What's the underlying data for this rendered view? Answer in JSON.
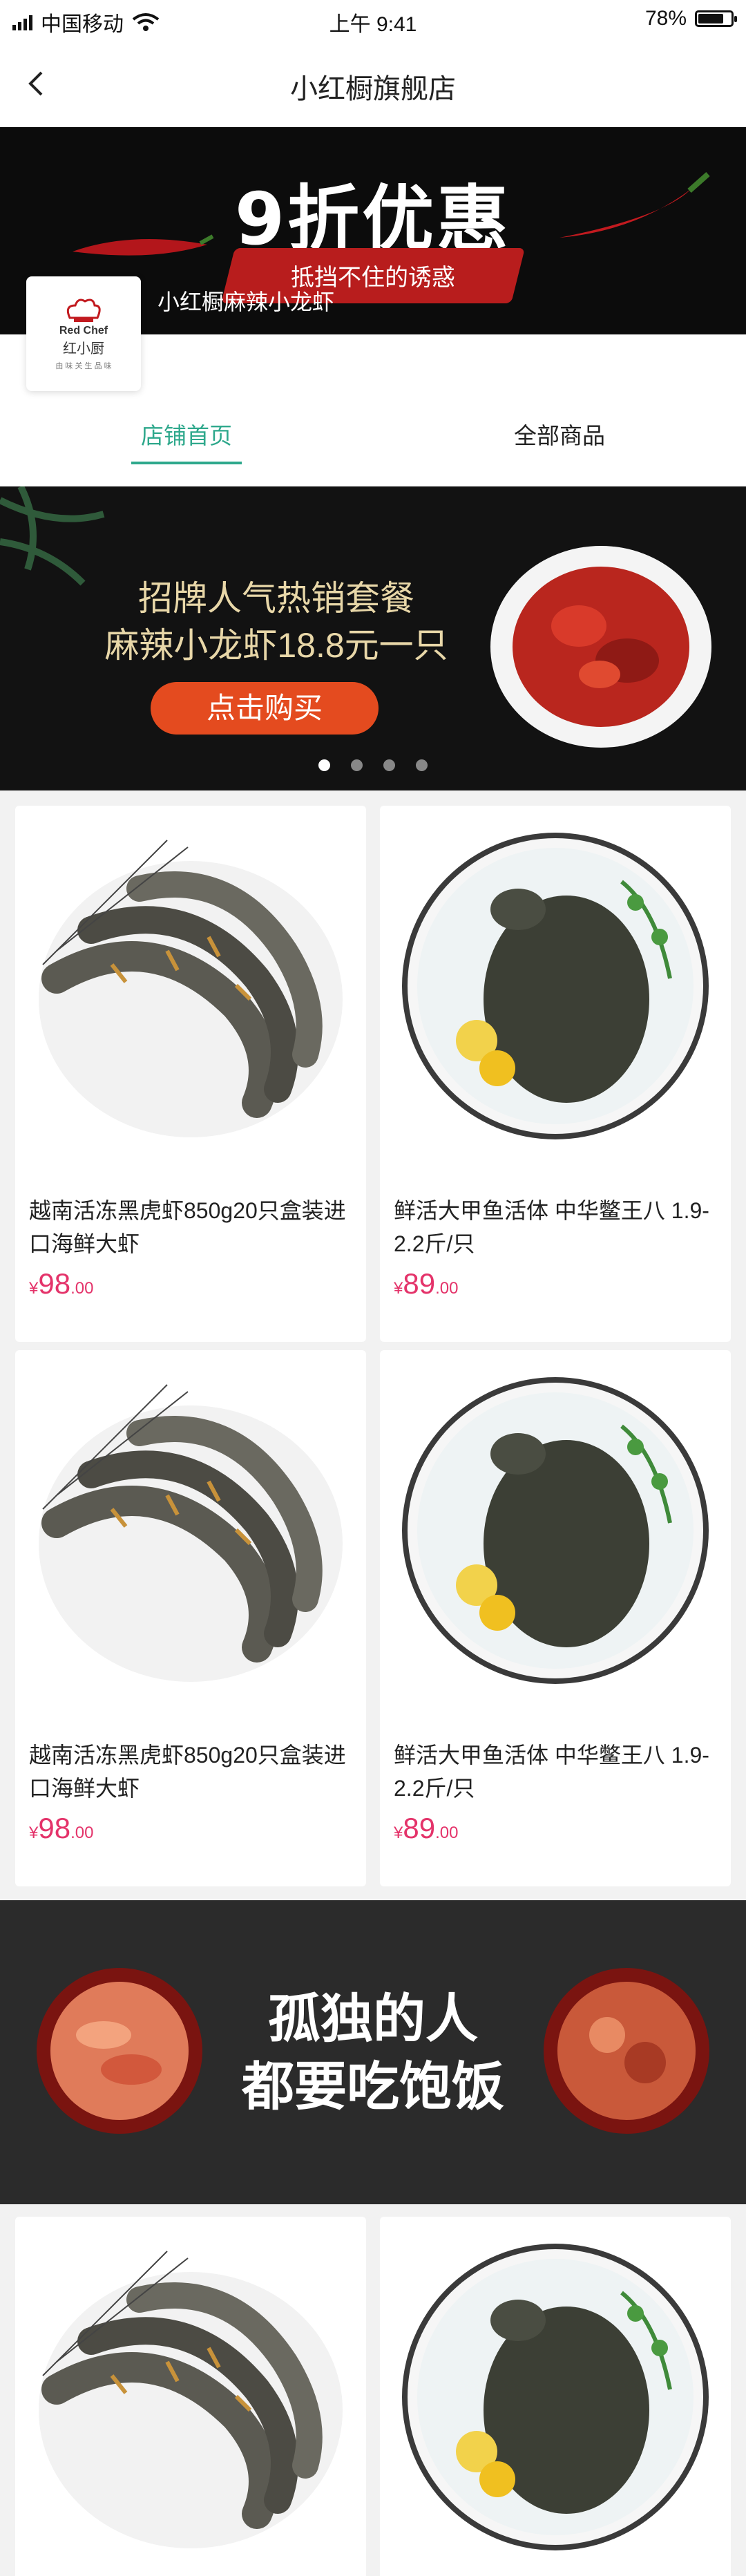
{
  "status_bar": {
    "carrier": "中国移动",
    "time": "上午 9:41",
    "battery": "78%",
    "battery_level": 0.78
  },
  "nav": {
    "title": "小红橱旗舰店"
  },
  "store_banner": {
    "deal": "9折优惠",
    "slogan": "抵挡不住的诱惑",
    "store_name": "小红橱麻辣小龙虾"
  },
  "logo": {
    "en": "Red Chef",
    "cn": "红小厨",
    "sub": "由 味 关 生 品 味"
  },
  "tabs": [
    {
      "label": "店铺首页"
    },
    {
      "label": "全部商品"
    }
  ],
  "promo": {
    "line1": "招牌人气热销套餐",
    "line2": "麻辣小龙虾18.8元一只",
    "button": "点击购买",
    "slides": 4,
    "active_slide": 1
  },
  "products": [
    {
      "name": "越南活冻黑虎虾850g20只盒装进口海鲜大虾",
      "currency": "¥",
      "price_int": "98",
      "price_dec": ".00",
      "image": "shrimp"
    },
    {
      "name": "鲜活大甲鱼活体 中华鳖王八 1.9-2.2斤/只",
      "currency": "¥",
      "price_int": "89",
      "price_dec": ".00",
      "image": "turtle"
    },
    {
      "name": "越南活冻黑虎虾850g20只盒装进口海鲜大虾",
      "currency": "¥",
      "price_int": "98",
      "price_dec": ".00",
      "image": "shrimp"
    },
    {
      "name": "鲜活大甲鱼活体 中华鳖王八 1.9-2.2斤/只",
      "currency": "¥",
      "price_int": "89",
      "price_dec": ".00",
      "image": "turtle"
    }
  ],
  "ad_banner": {
    "line1": "孤独的人",
    "line2": "都要吃饱饭"
  },
  "colors": {
    "accent": "#2ea88c",
    "price": "#e4336a",
    "button": "#e44b1f"
  }
}
